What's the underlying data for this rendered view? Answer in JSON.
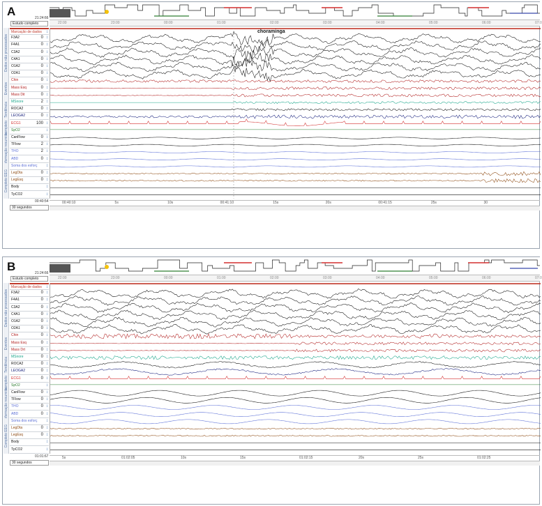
{
  "panels": [
    {
      "label": "A",
      "clock_top": "21:24:66",
      "study_select": "Estudo completo",
      "clock_bottom": "00:40:54",
      "window_select": "30 segundos",
      "annotation": "choraminga",
      "groups": [
        "Dados não processados",
        "Eventos",
        "Tendência",
        "completo",
        "informação resumida",
        "Completo EEG"
      ],
      "channels": [
        {
          "name": "Marcação de dados",
          "value": "",
          "color": "#c0392b"
        },
        {
          "name": "F3A2",
          "value": "0",
          "color": "#111"
        },
        {
          "name": "F4A1",
          "value": "0",
          "color": "#111"
        },
        {
          "name": "C3A2",
          "value": "0",
          "color": "#111"
        },
        {
          "name": "C4A1",
          "value": "0",
          "color": "#111"
        },
        {
          "name": "O1A2",
          "value": "0",
          "color": "#111"
        },
        {
          "name": "O2A1",
          "value": "0",
          "color": "#111"
        },
        {
          "name": "Chin",
          "value": "0",
          "color": "#b22222"
        },
        {
          "name": "Mass Esq",
          "value": "0",
          "color": "#b22222"
        },
        {
          "name": "Mass Dit",
          "value": "0",
          "color": "#b22222"
        },
        {
          "name": "MSnore",
          "value": "2",
          "color": "#17a589"
        },
        {
          "name": "ROCA2",
          "value": "0",
          "color": "#111"
        },
        {
          "name": "LEOGA2",
          "value": "0",
          "color": "#1a237e"
        },
        {
          "name": "ECG1",
          "value": "100",
          "color": "#d32f2f"
        },
        {
          "name": "SpO2",
          "value": "",
          "color": "#2e7d32"
        },
        {
          "name": "CanFlow",
          "value": "0",
          "color": "#111"
        },
        {
          "name": "TFlow",
          "value": "2",
          "color": "#111"
        },
        {
          "name": "THO",
          "value": "2",
          "color": "#5b6fd6"
        },
        {
          "name": "ABD",
          "value": "0",
          "color": "#5b6fd6"
        },
        {
          "name": "Soma dos esforç",
          "value": "",
          "color": "#5b6fd6"
        },
        {
          "name": "LegDta",
          "value": "0",
          "color": "#8d4a12"
        },
        {
          "name": "LegEsq",
          "value": "0",
          "color": "#8d4a12"
        },
        {
          "name": "Body",
          "value": "",
          "color": "#111"
        },
        {
          "name": "TpCO2",
          "value": "",
          "color": "#111"
        }
      ],
      "ruler_ticks": [
        "00:40:10",
        "5s",
        "10s",
        "00:41:10",
        "15s",
        "20s",
        "00:41:15",
        "25s",
        "30"
      ],
      "hyp_times": [
        "22:00",
        "23:00",
        "00:00",
        "01:00",
        "02:00",
        "03:00",
        "04:00",
        "05:00",
        "06:00",
        "07:00"
      ]
    },
    {
      "label": "B",
      "clock_top": "21:24:66",
      "study_select": "Estudo completo",
      "clock_bottom": "01:01:67",
      "window_select": "30 segundos",
      "annotation": "",
      "groups": [
        "Dados não processados",
        "Eventos",
        "Tendência",
        "completo",
        "informação resumida",
        "Completo EEG"
      ],
      "channels": [
        {
          "name": "Marcação de dados",
          "value": "",
          "color": "#c0392b"
        },
        {
          "name": "F3A2",
          "value": "0",
          "color": "#111"
        },
        {
          "name": "F4A1",
          "value": "0",
          "color": "#111"
        },
        {
          "name": "C3A2",
          "value": "0",
          "color": "#111"
        },
        {
          "name": "C4A1",
          "value": "0",
          "color": "#111"
        },
        {
          "name": "O1A2",
          "value": "0",
          "color": "#111"
        },
        {
          "name": "O2A1",
          "value": "0",
          "color": "#111"
        },
        {
          "name": "Chin",
          "value": "0",
          "color": "#b22222"
        },
        {
          "name": "Mass Esq",
          "value": "0",
          "color": "#b22222"
        },
        {
          "name": "Mass Drt",
          "value": "0",
          "color": "#b22222"
        },
        {
          "name": "MSnore",
          "value": "0",
          "color": "#17a589"
        },
        {
          "name": "ROCA2",
          "value": "0",
          "color": "#111"
        },
        {
          "name": "LEOGA2",
          "value": "0",
          "color": "#1a237e"
        },
        {
          "name": "ECG1",
          "value": "0",
          "color": "#d32f2f"
        },
        {
          "name": "SpO2",
          "value": "",
          "color": "#2e7d32"
        },
        {
          "name": "CanFlow",
          "value": "0",
          "color": "#111"
        },
        {
          "name": "TFlow",
          "value": "0",
          "color": "#111"
        },
        {
          "name": "THO",
          "value": "0",
          "color": "#5b6fd6"
        },
        {
          "name": "ABD",
          "value": "0",
          "color": "#5b6fd6"
        },
        {
          "name": "Soma dos esforç",
          "value": "",
          "color": "#5b6fd6"
        },
        {
          "name": "LegDta",
          "value": "0",
          "color": "#8d4a12"
        },
        {
          "name": "LegEsq",
          "value": "0",
          "color": "#8d4a12"
        },
        {
          "name": "Body",
          "value": "",
          "color": "#111"
        },
        {
          "name": "TpCO2",
          "value": "",
          "color": "#111"
        }
      ],
      "ruler_ticks": [
        "5s",
        "01:02:05",
        "10s",
        "15s",
        "01:02:15",
        "20s",
        "25s",
        "01:02:25"
      ],
      "hyp_times": [
        "22:00",
        "23:00",
        "00:00",
        "01:00",
        "02:00",
        "03:00",
        "04:00",
        "05:00",
        "06:00",
        "07:00"
      ]
    }
  ]
}
